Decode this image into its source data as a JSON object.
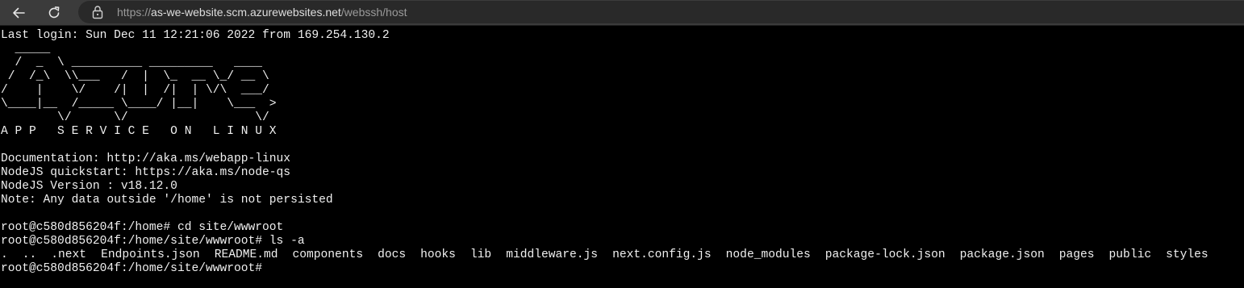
{
  "browser": {
    "url_scheme": "https://",
    "url_host": "as-we-website.scm.azurewebsites.net",
    "url_path": "/webssh/host",
    "icons": {
      "back": "back-arrow-icon",
      "reload": "reload-icon",
      "lock": "lock-icon"
    }
  },
  "terminal": {
    "last_login": "Last login: Sun Dec 11 12:21:06 2022 from 169.254.130.2",
    "banner": [
      "  _____",
      "  /  _  \\ __________ _________   ____",
      " /  /_\\  \\\\___   /  |  \\_  __ \\_/ __ \\",
      "/    |    \\/    /|  |  /|  | \\/\\  ___/",
      "\\____|__  /_____ \\____/ |__|    \\___  >",
      "        \\/      \\/                  \\/",
      "A P P   S E R V I C E   O N   L I N U X"
    ],
    "info": [
      "Documentation: http://aka.ms/webapp-linux",
      "NodeJS quickstart: https://aka.ms/node-qs",
      "NodeJS Version : v18.12.0",
      "Note: Any data outside '/home' is not persisted"
    ],
    "commands": [
      "root@c580d856204f:/home# cd site/wwwroot",
      "root@c580d856204f:/home/site/wwwroot# ls -a"
    ],
    "ls_entries": [
      ".",
      "..",
      ".next",
      "Endpoints.json",
      "README.md",
      "components",
      "docs",
      "hooks",
      "lib",
      "middleware.js",
      "next.config.js",
      "node_modules",
      "package-lock.json",
      "package.json",
      "pages",
      "public",
      "styles"
    ],
    "prompt": "root@c580d856204f:/home/site/wwwroot#"
  },
  "colors": {
    "terminal_bg": "#000000",
    "terminal_fg": "#f0f0f0",
    "toolbar_bg": "#3b3b3b",
    "address_bg": "#292929"
  }
}
